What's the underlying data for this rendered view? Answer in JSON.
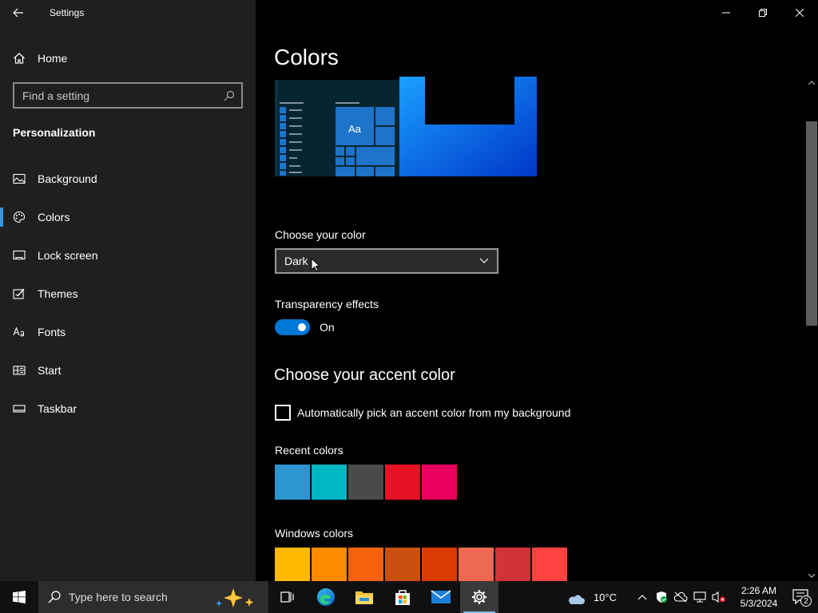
{
  "window": {
    "title": "Settings"
  },
  "sidebar": {
    "home_label": "Home",
    "search_placeholder": "Find a setting",
    "section": "Personalization",
    "items": [
      {
        "label": "Background",
        "icon": "image-icon"
      },
      {
        "label": "Colors",
        "icon": "palette-icon"
      },
      {
        "label": "Lock screen",
        "icon": "lock-screen-icon"
      },
      {
        "label": "Themes",
        "icon": "brush-icon"
      },
      {
        "label": "Fonts",
        "icon": "font-icon"
      },
      {
        "label": "Start",
        "icon": "start-icon"
      },
      {
        "label": "Taskbar",
        "icon": "taskbar-icon"
      }
    ],
    "active_item": "Colors"
  },
  "main": {
    "title": "Colors",
    "preview_text": "Aa",
    "choose_color_label": "Choose your color",
    "choose_color_value": "Dark",
    "transparency_label": "Transparency effects",
    "transparency_state": "On",
    "accent_heading": "Choose your accent color",
    "auto_pick_label": "Automatically pick an accent color from my background",
    "recent_colors_label": "Recent colors",
    "recent_colors": [
      "#2d96d0",
      "#00b7c3",
      "#4c4a48",
      "#e81123",
      "#ea005e"
    ],
    "windows_colors_label": "Windows colors",
    "windows_colors": [
      "#ffb900",
      "#ff8c00",
      "#f7630c",
      "#ca5010",
      "#da3b01",
      "#ef6950",
      "#d13438",
      "#ff4343"
    ]
  },
  "taskbar": {
    "search_placeholder": "Type here to search",
    "weather_temp": "10°C",
    "time": "2:26 AM",
    "date": "5/3/2024",
    "notification_count": "2",
    "apps": [
      "task-view-icon",
      "edge-icon",
      "file-explorer-icon",
      "store-icon",
      "mail-icon",
      "settings-icon"
    ]
  },
  "colors": {
    "accent": "#0078d7",
    "sidebar_bg": "#1f1f1f",
    "main_bg": "#000000"
  }
}
